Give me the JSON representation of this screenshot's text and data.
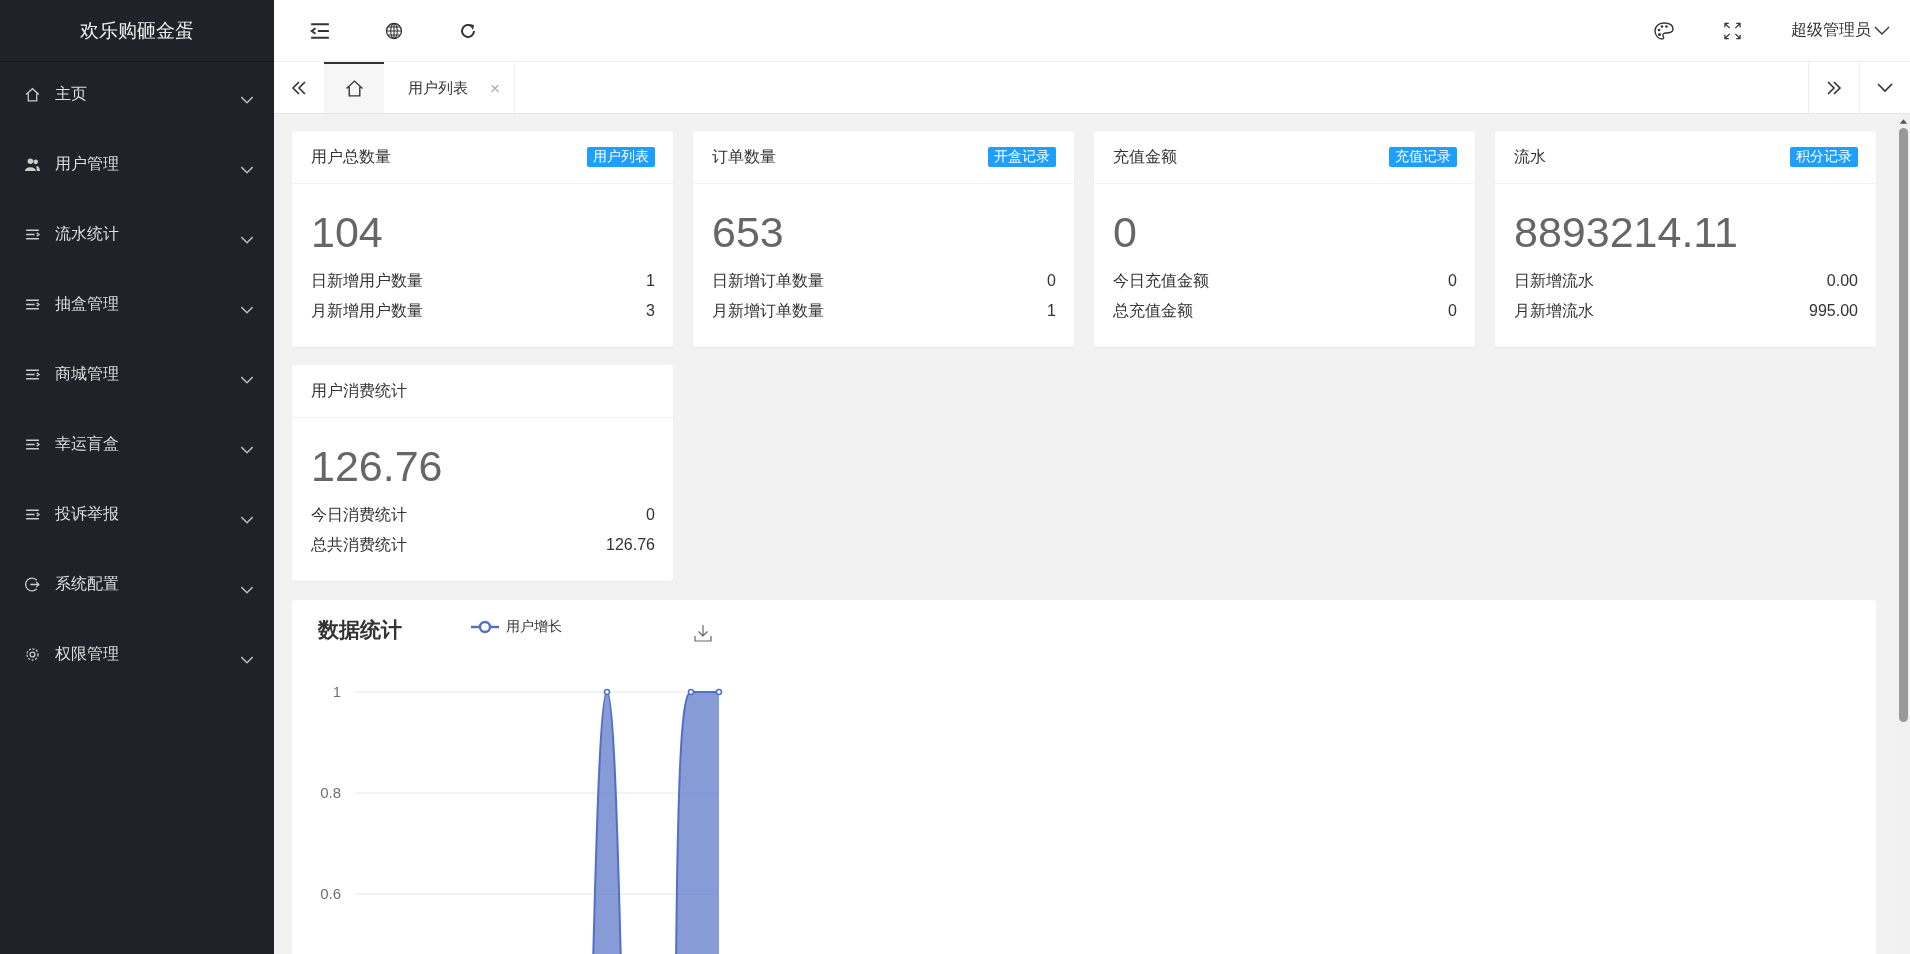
{
  "sidebar": {
    "logo": "欢乐购砸金蛋",
    "items": [
      {
        "label": "主页",
        "expanded": false
      },
      {
        "label": "用户管理",
        "expanded": false
      },
      {
        "label": "流水统计",
        "expanded": false
      },
      {
        "label": "抽盒管理",
        "expanded": false
      },
      {
        "label": "商城管理",
        "expanded": false
      },
      {
        "label": "幸运盲盒",
        "expanded": false
      },
      {
        "label": "投诉举报",
        "expanded": false
      },
      {
        "label": "系统配置",
        "expanded": false
      },
      {
        "label": "权限管理",
        "expanded": false
      }
    ]
  },
  "header": {
    "user": "超级管理员"
  },
  "tabs": [
    {
      "kind": "home",
      "selected": true
    },
    {
      "kind": "page",
      "label": "用户列表",
      "close": "×",
      "selected": false
    }
  ],
  "stat_cards": [
    {
      "title": "用户总数量",
      "badge": "用户列表",
      "value": "104",
      "rows": [
        {
          "label": "日新增用户数量",
          "value": "1"
        },
        {
          "label": "月新增用户数量",
          "value": "3"
        }
      ]
    },
    {
      "title": "订单数量",
      "badge": "开盒记录",
      "value": "653",
      "rows": [
        {
          "label": "日新增订单数量",
          "value": "0"
        },
        {
          "label": "月新增订单数量",
          "value": "1"
        }
      ]
    },
    {
      "title": "充值金额",
      "badge": "充值记录",
      "value": "0",
      "rows": [
        {
          "label": "今日充值金额",
          "value": "0"
        },
        {
          "label": "总充值金额",
          "value": "0"
        }
      ]
    },
    {
      "title": "流水",
      "badge": "积分记录",
      "value": "8893214.11",
      "rows": [
        {
          "label": "日新增流水",
          "value": "0.00"
        },
        {
          "label": "月新增流水",
          "value": "995.00"
        }
      ]
    },
    {
      "title": "用户消费统计",
      "value": "126.76",
      "rows": [
        {
          "label": "今日消费统计",
          "value": "0"
        },
        {
          "label": "总共消费统计",
          "value": "126.76"
        }
      ]
    }
  ],
  "chart_panel": {
    "title": "数据统计",
    "legend": "用户增长",
    "y_axis_labels": [
      "1",
      "0.8",
      "0.6"
    ]
  }
}
